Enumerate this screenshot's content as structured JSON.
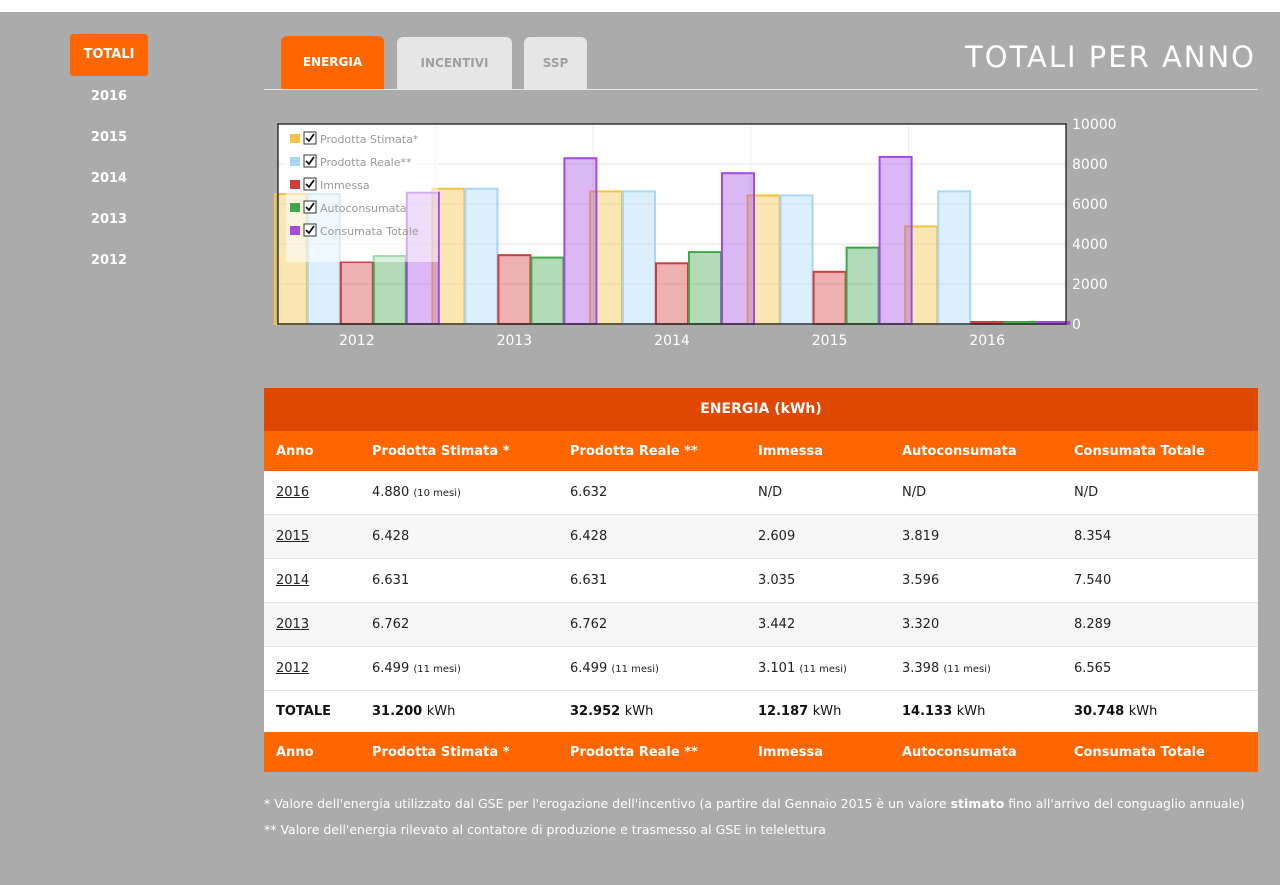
{
  "sidebar": {
    "items": [
      {
        "label": "TOTALI",
        "active": true
      },
      {
        "label": "2016"
      },
      {
        "label": "2015"
      },
      {
        "label": "2014"
      },
      {
        "label": "2013"
      },
      {
        "label": "2012"
      }
    ]
  },
  "tabs": [
    {
      "label": "ENERGIA",
      "active": true
    },
    {
      "label": "INCENTIVI"
    },
    {
      "label": "SSP"
    }
  ],
  "page_title": "TOTALI PER ANNO",
  "chart_data": {
    "type": "bar",
    "categories": [
      "2012",
      "2013",
      "2014",
      "2015",
      "2016"
    ],
    "ylim": [
      0,
      10000
    ],
    "yticks": [
      "0",
      "2000",
      "4000",
      "6000",
      "8000",
      "10000"
    ],
    "legend_position": "top-left",
    "grid": true,
    "series": [
      {
        "name": "Prodotta Stimata*",
        "values": [
          6499,
          6762,
          6631,
          6428,
          4880
        ],
        "color": "#f5c242"
      },
      {
        "name": "Prodotta Reale**",
        "values": [
          6499,
          6762,
          6631,
          6428,
          6632
        ],
        "color": "#a8d6f7"
      },
      {
        "name": "Immessa",
        "values": [
          3101,
          3442,
          3035,
          2609,
          0
        ],
        "color": "#d13b3b"
      },
      {
        "name": "Autoconsumata",
        "values": [
          3398,
          3320,
          3596,
          3819,
          0
        ],
        "color": "#3ea84a"
      },
      {
        "name": "Consumata Totale",
        "values": [
          6565,
          8289,
          7540,
          8354,
          0
        ],
        "color": "#a44ae0"
      }
    ]
  },
  "table": {
    "caption": "ENERGIA (kWh)",
    "headers": [
      "Anno",
      "Prodotta Stimata *",
      "Prodotta Reale **",
      "Immessa",
      "Autoconsumata",
      "Consumata Totale"
    ],
    "rows": [
      {
        "year": "2016",
        "cells": [
          {
            "v": "4.880",
            "n": "(10 mesi)"
          },
          {
            "v": "6.632"
          },
          {
            "v": "N/D"
          },
          {
            "v": "N/D"
          },
          {
            "v": "N/D"
          }
        ]
      },
      {
        "year": "2015",
        "cells": [
          {
            "v": "6.428"
          },
          {
            "v": "6.428"
          },
          {
            "v": "2.609"
          },
          {
            "v": "3.819"
          },
          {
            "v": "8.354"
          }
        ]
      },
      {
        "year": "2014",
        "cells": [
          {
            "v": "6.631"
          },
          {
            "v": "6.631"
          },
          {
            "v": "3.035"
          },
          {
            "v": "3.596"
          },
          {
            "v": "7.540"
          }
        ]
      },
      {
        "year": "2013",
        "cells": [
          {
            "v": "6.762"
          },
          {
            "v": "6.762"
          },
          {
            "v": "3.442"
          },
          {
            "v": "3.320"
          },
          {
            "v": "8.289"
          }
        ]
      },
      {
        "year": "2012",
        "cells": [
          {
            "v": "6.499",
            "n": "(11 mesi)"
          },
          {
            "v": "6.499",
            "n": "(11 mesi)"
          },
          {
            "v": "3.101",
            "n": "(11 mesi)"
          },
          {
            "v": "3.398",
            "n": "(11 mesi)"
          },
          {
            "v": "6.565"
          }
        ]
      }
    ],
    "total_label": "TOTALE",
    "totals": [
      "31.200",
      "32.952",
      "12.187",
      "14.133",
      "30.748"
    ],
    "unit": "kWh"
  },
  "footnotes": {
    "note1_a": "* Valore dell'energia utilizzato dal GSE per l'erogazione dell'incentivo (a partire dal Gennaio 2015 è un valore ",
    "note1_bold": "stimato",
    "note1_b": " fino all'arrivo del conguaglio annuale)",
    "note2": "** Valore dell'energia rilevato al contatore di produzione e trasmesso al GSE in telelettura"
  }
}
